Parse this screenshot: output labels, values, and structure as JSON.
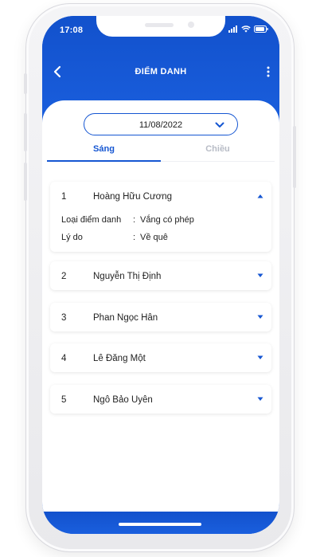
{
  "status_bar": {
    "time": "17:08"
  },
  "header": {
    "title": "ĐIỂM DANH"
  },
  "date_picker": {
    "value": "11/08/2022"
  },
  "tabs": [
    {
      "label": "Sáng",
      "active": true
    },
    {
      "label": "Chiều",
      "active": false
    }
  ],
  "students": [
    {
      "index": "1",
      "name": "Hoàng Hữu Cương",
      "expanded": true,
      "details": {
        "type_label": "Loại điểm danh",
        "type_value": "Vắng có phép",
        "reason_label": "Lý do",
        "reason_value": "Về quê"
      }
    },
    {
      "index": "2",
      "name": "Nguyễn Thị Định",
      "expanded": false
    },
    {
      "index": "3",
      "name": "Phan Ngọc Hân",
      "expanded": false
    },
    {
      "index": "4",
      "name": "Lê Đăng Một",
      "expanded": false
    },
    {
      "index": "5",
      "name": "Ngô Bảo Uyên",
      "expanded": false
    }
  ],
  "colors": {
    "primary": "#1556d2",
    "inactive_tab": "#b8bcc6"
  },
  "icons": [
    "back-arrow-icon",
    "more-vertical-icon",
    "chevron-down-icon",
    "caret-up-icon",
    "caret-down-icon",
    "signal-icon",
    "wifi-icon",
    "battery-icon"
  ]
}
